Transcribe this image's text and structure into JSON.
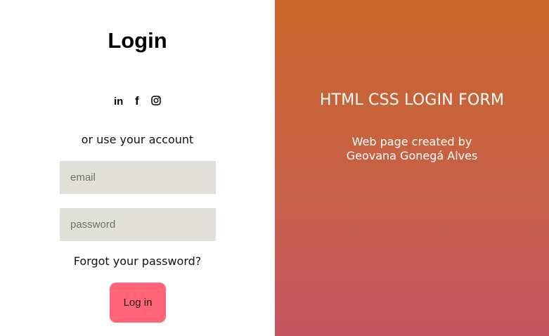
{
  "login_panel": {
    "title": "Login",
    "social_icons": [
      {
        "icon": "linkedin-icon",
        "glyph": "in"
      },
      {
        "icon": "facebook-icon",
        "glyph": "f"
      },
      {
        "icon": "instagram-icon"
      }
    ],
    "alt_text": "or use your account",
    "email_placeholder": "email",
    "password_placeholder": "password",
    "forgot_link": "Forgot your password?",
    "login_button": "Log in",
    "button_color": "#ff6577",
    "field_color": "#e0e0d9"
  },
  "info_panel": {
    "title": "HTML CSS LOGIN FORM",
    "subtitle_line1": "Web page created by",
    "subtitle_line2": "Geovana Gonegá Alves",
    "gradient_top": "#c96628",
    "gradient_bottom": "#c55562"
  }
}
